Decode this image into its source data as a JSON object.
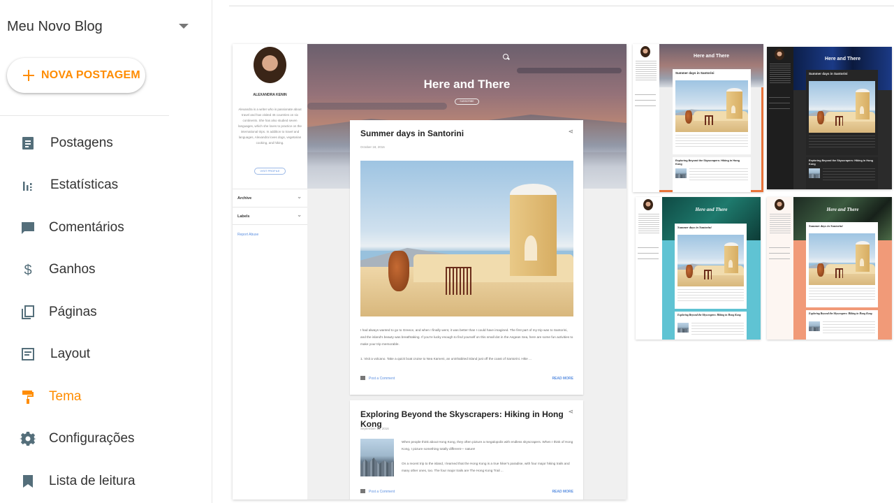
{
  "sidebar": {
    "blog_name": "Meu Novo Blog",
    "new_post_label": "NOVA POSTAGEM",
    "items": [
      {
        "label": "Postagens",
        "icon": "posts-icon"
      },
      {
        "label": "Estatísticas",
        "icon": "stats-icon"
      },
      {
        "label": "Comentários",
        "icon": "comments-icon"
      },
      {
        "label": "Ganhos",
        "icon": "dollar-icon"
      },
      {
        "label": "Páginas",
        "icon": "pages-icon"
      },
      {
        "label": "Layout",
        "icon": "layout-icon"
      },
      {
        "label": "Tema",
        "icon": "theme-icon",
        "active": true
      },
      {
        "label": "Configurações",
        "icon": "gear-icon"
      },
      {
        "label": "Lista de leitura",
        "icon": "bookmark-icon"
      }
    ]
  },
  "colors": {
    "accent": "#ff8c00",
    "icon_gray": "#546e7a",
    "selected_outline": "#e8733a",
    "link_blue": "#5b8fe0"
  },
  "preview": {
    "author": "ALEXANDRA KENIN",
    "bio": "Alexandra is a writer who is passionate about travel and has visited 46 countries on six continents. She has also studied seven languages, which she loves to practice on the international trips. In addition to travel and languages, Alexandra loves dogs, vegetarian cooking, and hiking.",
    "visit_profile": "VISIT PROFILE",
    "archive": "Archive",
    "labels": "Labels",
    "report_abuse": "Report Abuse",
    "blog_title": "Here and There",
    "subscribe": "SUBSCRIBE",
    "post1": {
      "title": "Summer days in Santorini",
      "date": "October 18, 2016",
      "text": "I had always wanted to go to Greece, and when I finally went, it was better than I could have imagined. The first part of my trip was to Santorini, and the island's beauty was breathtaking. If you're lucky enough to find yourself on this small dot in the Aegean Sea, here are some fun activities to make your trip memorable.",
      "bullet": "1. Visit a volcano. Take a quick boat cruise to Nea Kameni, an uninhabited island just off the coast of Santorini. Hike ...",
      "comment_link": "Post a Comment",
      "read_more": "READ MORE"
    },
    "post2": {
      "title": "Exploring Beyond the Skyscrapers: Hiking in Hong Kong",
      "date": "September 12, 2016",
      "text1": "When people think about Hong Kong, they often picture a megalopolis with endless skyscrapers. When I think of Hong Kong, I picture something totally different— nature!",
      "text2": "On a recent trip to the island, I learned that the Hong Kong is a true hiker's paradise, with four major hiking trails and many other ones, too. The four major trails are The Hong Kong Trail ...",
      "comment_link": "Post a Comment",
      "read_more": "READ MORE"
    }
  },
  "themes": [
    {
      "title": "Here and There",
      "post1": "Summer days in Santorini",
      "post2": "Exploring Beyond the Skyscrapers: Hiking in Hong Kong",
      "style": "light",
      "selected": true
    },
    {
      "title": "Here and There",
      "post1": "Summer days in Santorini",
      "post2": "Exploring Beyond the Skyscrapers: Hiking in Hong Kong",
      "style": "dark",
      "selected": false
    },
    {
      "title": "Here and There",
      "post1": "Summer days in Santorini",
      "post2": "Exploring Beyond the Skyscrapers: Hiking in Hong Kong",
      "style": "teal",
      "selected": false
    },
    {
      "title": "Here and There",
      "post1": "Summer days in Santorini",
      "post2": "Exploring Beyond the Skyscrapers: Hiking in Hong Kong",
      "style": "coral",
      "selected": false
    }
  ]
}
